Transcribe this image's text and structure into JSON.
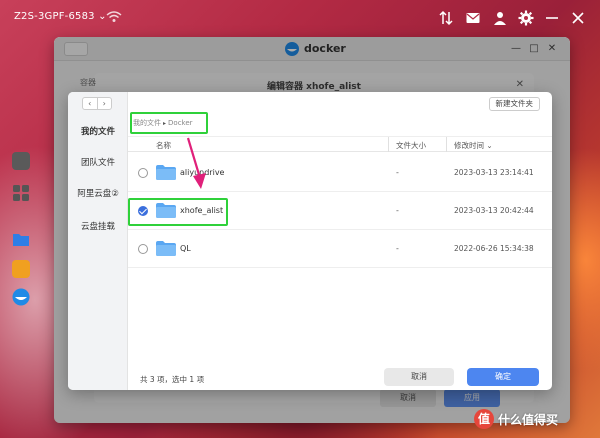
{
  "topbar": {
    "device_name": "Z2S-3GPF-6583 ⌄"
  },
  "docker_window": {
    "title": "docker",
    "controls": [
      "—",
      "□",
      "✕"
    ]
  },
  "edit_dialog": {
    "title": "编辑容器 xhofe_alist",
    "side_label": "容器",
    "buttons": [
      "取消",
      "应用"
    ]
  },
  "picker": {
    "nav_back": "‹",
    "nav_forward": "›",
    "new_folder": "新建文件夹",
    "sidebar": [
      "我的文件",
      "团队文件",
      "阿里云盘②",
      "云盘挂载"
    ],
    "breadcrumb": [
      "我的文件",
      "Docker"
    ],
    "columns": {
      "name": "名称",
      "size": "文件大小",
      "modified": "修改时间 ⌄"
    },
    "rows": [
      {
        "name": "aliyundrive",
        "size": "-",
        "date": "2023-03-13 23:14:41",
        "selected": false
      },
      {
        "name": "xhofe_alist",
        "size": "-",
        "date": "2023-03-13 20:42:44",
        "selected": true
      },
      {
        "name": "QL",
        "size": "-",
        "date": "2022-06-26 15:34:38",
        "selected": false
      }
    ],
    "status": "共 3 项，选中 1 项",
    "cancel": "取消",
    "ok": "确定"
  },
  "watermark": {
    "text": "什么值得买",
    "logo": "值"
  },
  "colors": {
    "accent": "#4d86f0",
    "highlight": "#2fd13a",
    "arrow": "#e0207a"
  }
}
